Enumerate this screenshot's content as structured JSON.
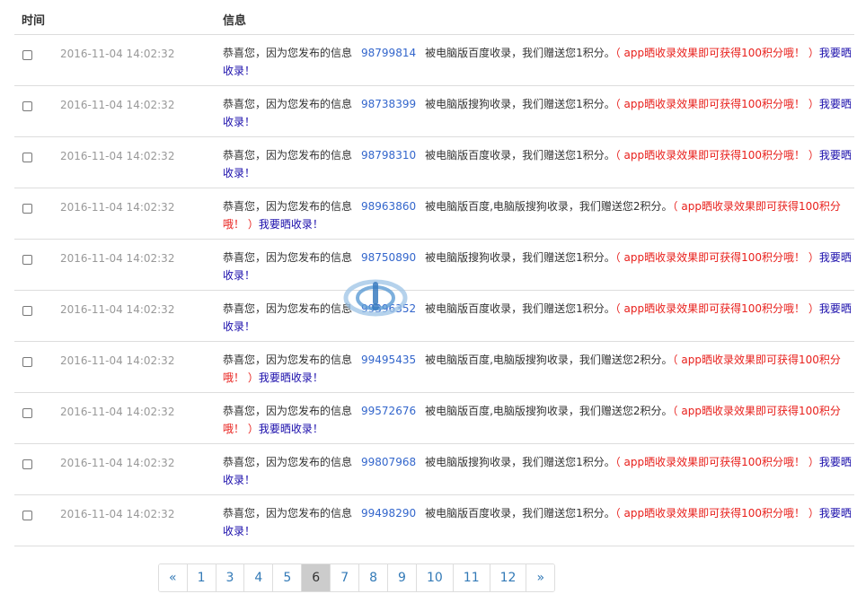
{
  "header": {
    "col_time": "时间",
    "col_info": "信息"
  },
  "rows": [
    {
      "time": "2016-11-04 14:02:32",
      "prefix": "恭喜您，因为您发布的信息",
      "id": "98799814",
      "desc": "被电脑版百度收录，我们赠送您1积分。",
      "promo": "（ app晒收录效果即可获得100积分哦！ ）",
      "link": "我要晒收录！"
    },
    {
      "time": "2016-11-04 14:02:32",
      "prefix": "恭喜您，因为您发布的信息",
      "id": "98738399",
      "desc": "被电脑版搜狗收录，我们赠送您1积分。",
      "promo": "（ app晒收录效果即可获得100积分哦！ ）",
      "link": "我要晒收录！"
    },
    {
      "time": "2016-11-04 14:02:32",
      "prefix": "恭喜您，因为您发布的信息",
      "id": "98798310",
      "desc": "被电脑版百度收录，我们赠送您1积分。",
      "promo": "（ app晒收录效果即可获得100积分哦！ ）",
      "link": "我要晒收录！"
    },
    {
      "time": "2016-11-04 14:02:32",
      "prefix": "恭喜您，因为您发布的信息",
      "id": "98963860",
      "desc": "被电脑版百度,电脑版搜狗收录，我们赠送您2积分。",
      "promo": "（ app晒收录效果即可获得100积分哦！ ）",
      "link": "我要晒收录！"
    },
    {
      "time": "2016-11-04 14:02:32",
      "prefix": "恭喜您，因为您发布的信息",
      "id": "98750890",
      "desc": "被电脑版搜狗收录，我们赠送您1积分。",
      "promo": "（ app晒收录效果即可获得100积分哦！ ）",
      "link": "我要晒收录！"
    },
    {
      "time": "2016-11-04 14:02:32",
      "prefix": "恭喜您，因为您发布的信息",
      "id": "99396352",
      "desc": "被电脑版百度收录，我们赠送您1积分。",
      "promo": "（ app晒收录效果即可获得100积分哦！ ）",
      "link": "我要晒收录！"
    },
    {
      "time": "2016-11-04 14:02:32",
      "prefix": "恭喜您，因为您发布的信息",
      "id": "99495435",
      "desc": "被电脑版百度,电脑版搜狗收录，我们赠送您2积分。",
      "promo": "（ app晒收录效果即可获得100积分哦！ ）",
      "link": "我要晒收录！"
    },
    {
      "time": "2016-11-04 14:02:32",
      "prefix": "恭喜您，因为您发布的信息",
      "id": "99572676",
      "desc": "被电脑版百度,电脑版搜狗收录，我们赠送您2积分。",
      "promo": "（ app晒收录效果即可获得100积分哦！ ）",
      "link": "我要晒收录！"
    },
    {
      "time": "2016-11-04 14:02:32",
      "prefix": "恭喜您，因为您发布的信息",
      "id": "99807968",
      "desc": "被电脑版搜狗收录，我们赠送您1积分。",
      "promo": "（ app晒收录效果即可获得100积分哦！ ）",
      "link": "我要晒收录！"
    },
    {
      "time": "2016-11-04 14:02:32",
      "prefix": "恭喜您，因为您发布的信息",
      "id": "99498290",
      "desc": "被电脑版百度收录，我们赠送您1积分。",
      "promo": "（ app晒收录效果即可获得100积分哦！ ）",
      "link": "我要晒收录！"
    }
  ],
  "pagination": {
    "prev": "«",
    "pages": [
      "1",
      "3",
      "4",
      "5",
      "6",
      "7",
      "8",
      "9",
      "10",
      "11",
      "12"
    ],
    "active": "6",
    "next": "»"
  },
  "colors": {
    "id_link": "#3366cc",
    "promo_red": "#e8201c",
    "action_blue": "#1a0dab",
    "time_gray": "#999999"
  }
}
